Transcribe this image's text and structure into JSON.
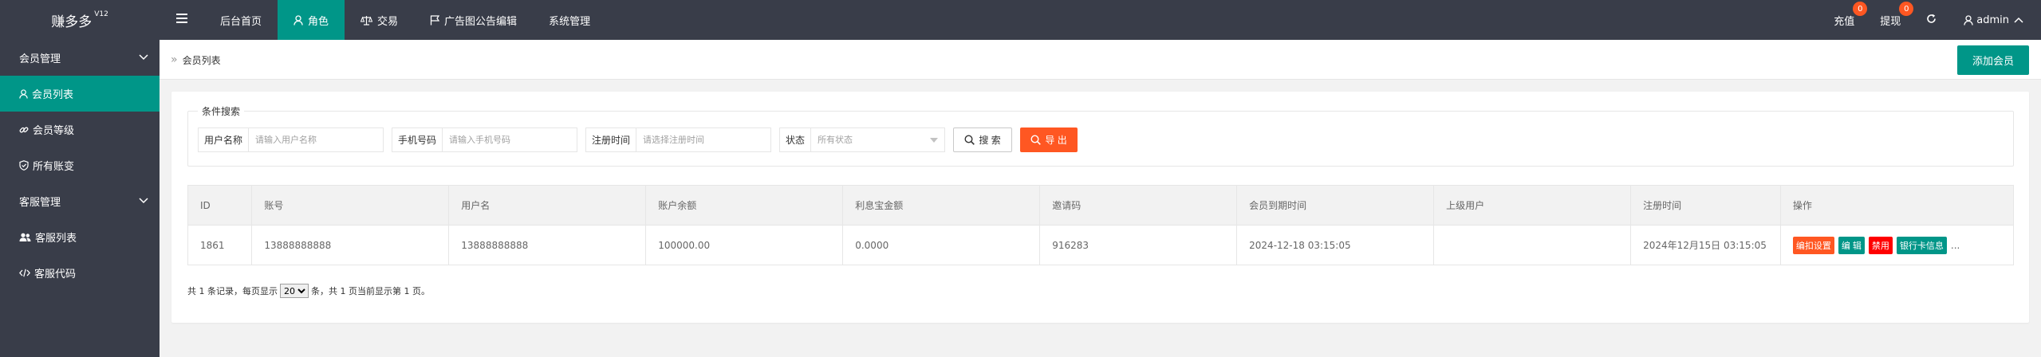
{
  "logo": {
    "name": "赚多多",
    "version": "V12"
  },
  "nav": {
    "items": [
      {
        "label": "后台首页",
        "icon": ""
      },
      {
        "label": "角色",
        "icon": "user-icon"
      },
      {
        "label": "交易",
        "icon": "scale-icon"
      },
      {
        "label": "广告图公告编辑",
        "icon": "flag-icon"
      },
      {
        "label": "系统管理",
        "icon": ""
      }
    ],
    "active": "角色"
  },
  "header_right": {
    "recharge": {
      "label": "充值",
      "badge": "0"
    },
    "withdraw": {
      "label": "提现",
      "badge": "0"
    },
    "admin": {
      "label": "admin"
    }
  },
  "sidebar": {
    "groups": [
      {
        "label": "会员管理",
        "items": [
          {
            "label": "会员列表",
            "icon": "user-icon"
          },
          {
            "label": "会员等级",
            "icon": "link-icon"
          },
          {
            "label": "所有账变",
            "icon": "shield-check-icon"
          }
        ]
      },
      {
        "label": "客服管理",
        "items": [
          {
            "label": "客服列表",
            "icon": "users-icon"
          },
          {
            "label": "客服代码",
            "icon": "code-icon"
          }
        ]
      }
    ],
    "active_item": "会员列表"
  },
  "breadcrumb": {
    "current": "会员列表"
  },
  "add_button": "添加会员",
  "search": {
    "legend": "条件搜索",
    "username": {
      "label": "用户名称",
      "placeholder": "请输入用户名称"
    },
    "phone": {
      "label": "手机号码",
      "placeholder": "请输入手机号码"
    },
    "regtime": {
      "label": "注册时间",
      "placeholder": "请选择注册时间"
    },
    "status": {
      "label": "状态",
      "value": "所有状态"
    },
    "search_btn": "搜 索",
    "export_btn": "导 出"
  },
  "table": {
    "columns": [
      "ID",
      "账号",
      "用户名",
      "账户余额",
      "利息宝金额",
      "邀请码",
      "会员到期时间",
      "上级用户",
      "注册时间",
      "操作"
    ],
    "rows": [
      {
        "id": "1861",
        "account": "13888888888",
        "username": "13888888888",
        "balance": "100000.00",
        "interest": "0.0000",
        "invite": "916283",
        "expire": "2024-12-18 03:15:05",
        "parent": "",
        "regtime": "2024年12月15日 03:15:05",
        "actions": [
          "编扣设置",
          "编 辑",
          "禁用",
          "银行卡信息"
        ],
        "more": "..."
      }
    ]
  },
  "pager": {
    "prefix": "共 1 条记录，每页显示",
    "page_size": "20",
    "suffix": "条，共 1 页当前显示第 1 页。"
  },
  "colors": {
    "header_bg": "#393d49",
    "accent": "#009688",
    "danger": "#ff5722"
  }
}
